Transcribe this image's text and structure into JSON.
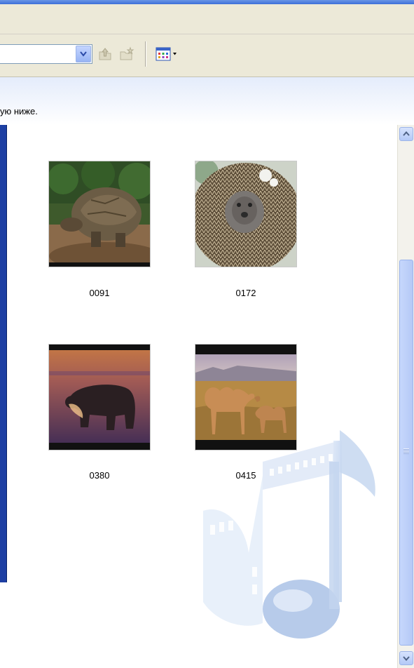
{
  "instruction": "ую ниже.",
  "thumbnails": [
    {
      "name": "0091",
      "subject": "tortoise"
    },
    {
      "name": "0172",
      "subject": "hedgehog"
    },
    {
      "name": "0380",
      "subject": "polar-bear"
    },
    {
      "name": "0415",
      "subject": "camels"
    }
  ],
  "toolbar": {
    "icons": [
      "combo-dropdown-icon",
      "up-folder-icon",
      "new-folder-icon",
      "views-icon"
    ]
  },
  "colors": {
    "toolbar_bg": "#ece9d8",
    "scroll_accent": "#b3c9f7",
    "left_panel": "#1d3fa3"
  }
}
